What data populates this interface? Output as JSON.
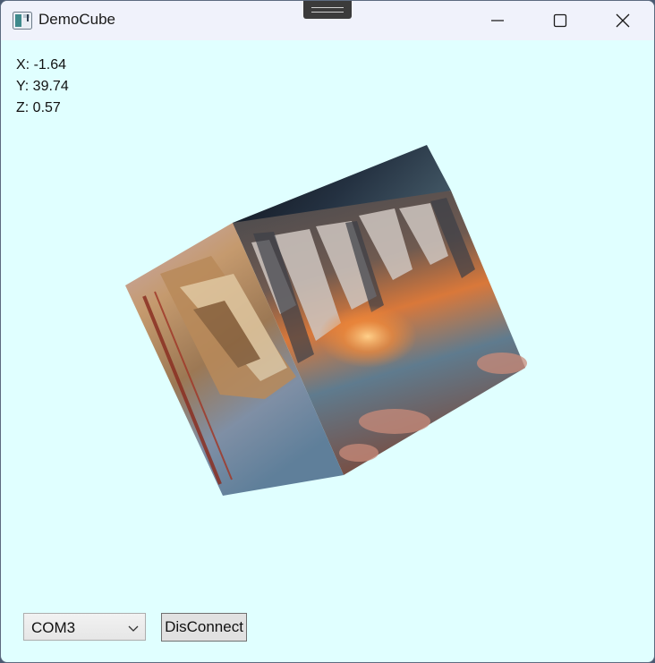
{
  "window": {
    "title": "DemoCube",
    "icon": "app-window-icon",
    "controls": [
      "minimize-icon",
      "maximize-icon",
      "close-icon"
    ]
  },
  "readout": {
    "x": "X: -1.64",
    "y": "Y: 39.74",
    "z": "Z: 0.57"
  },
  "cube": {
    "faces": [
      "tower-photo",
      "city-sunset-photo",
      "dark-sky-photo"
    ]
  },
  "controls": {
    "port_selected": "COM3",
    "disconnect_label": "DisConnect"
  },
  "colors": {
    "client_background": "#e0ffff",
    "titlebar_background": "#f0f2fb"
  }
}
